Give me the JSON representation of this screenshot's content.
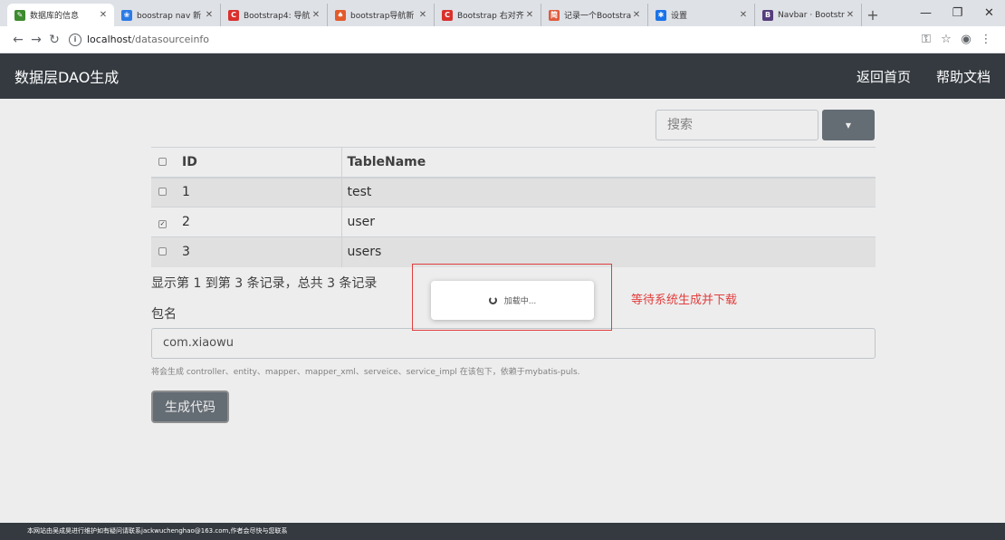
{
  "browser": {
    "tabs": [
      {
        "title": "数据库的信息",
        "icon": "doc-icon",
        "color": "#3d8a2f",
        "glyph": "✎",
        "active": true
      },
      {
        "title": "boostrap nav 新",
        "icon": "paw-icon",
        "color": "#2c7be5",
        "glyph": "❀"
      },
      {
        "title": "Bootstrap4: 导航",
        "icon": "csdn-icon",
        "color": "#d9302c",
        "glyph": "C"
      },
      {
        "title": "bootstrap导航新",
        "icon": "flame-icon",
        "color": "#e35b2a",
        "glyph": "♠"
      },
      {
        "title": "Bootstrap 右对齐",
        "icon": "csdn-icon",
        "color": "#d9302c",
        "glyph": "C"
      },
      {
        "title": "记录一个Bootstra",
        "icon": "jianshu-icon",
        "color": "#e05a3c",
        "glyph": "简"
      },
      {
        "title": "设置",
        "icon": "gear-icon",
        "color": "#1a73e8",
        "glyph": "✱"
      },
      {
        "title": "Navbar · Bootstra",
        "icon": "bootstrap-icon",
        "color": "#563d7c",
        "glyph": "B"
      }
    ],
    "new_tab_label": "+",
    "url_host": "localhost",
    "url_path": "/datasourceinfo"
  },
  "navbar": {
    "brand": "数据层DAO生成",
    "links": [
      "返回首页",
      "帮助文档"
    ]
  },
  "search": {
    "placeholder": "搜索"
  },
  "table": {
    "columns": [
      "ID",
      "TableName"
    ],
    "rows": [
      {
        "id": "1",
        "name": "test",
        "checked": false
      },
      {
        "id": "2",
        "name": "user",
        "checked": true
      },
      {
        "id": "3",
        "name": "users",
        "checked": false
      }
    ]
  },
  "summary": "显示第 1 到第 3 条记录，总共 3 条记录",
  "package": {
    "label": "包名",
    "value": "com.xiaowu",
    "hint": "将会生成 controller、entity、mapper、mapper_xml、serveice、service_impl 在该包下，依赖于mybatis-puls."
  },
  "generate_button": "生成代码",
  "loading": {
    "text": "加载中..."
  },
  "annotation": "等待系统生成并下载",
  "footer": "本网站由吴成昊进行维护如有疑问请联系jackwuchenghao@163.com,作者会尽快与您联系"
}
